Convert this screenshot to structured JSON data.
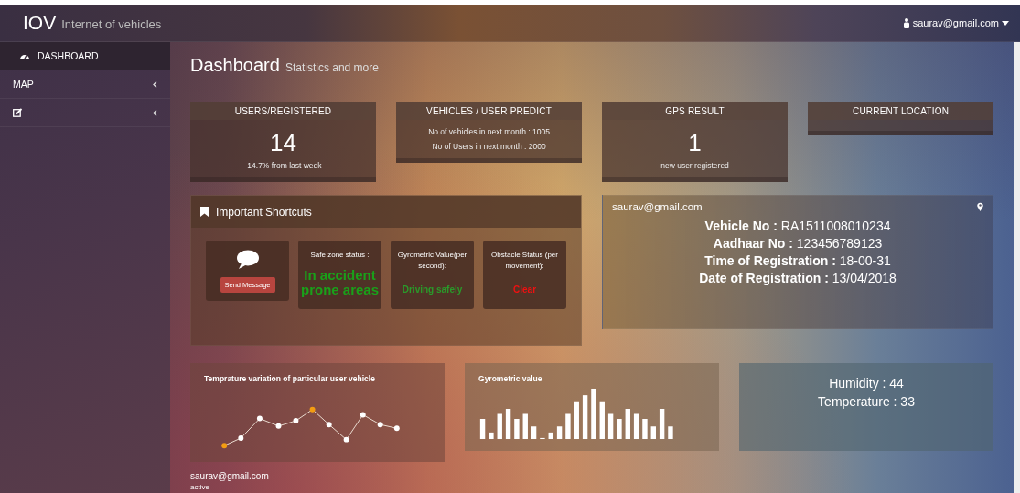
{
  "navbar": {
    "brand": "IOV",
    "tagline": "Internet of vehicles",
    "user": "saurav@gmail.com"
  },
  "sidebar": {
    "items": [
      {
        "kind": "dashboard",
        "label": "DASHBOARD",
        "selected": true
      },
      {
        "kind": "map",
        "label": "MAP",
        "selected": false
      },
      {
        "kind": "edit",
        "selected": false
      }
    ]
  },
  "page": {
    "title": "Dashboard",
    "subtitle": "Statistics and more"
  },
  "stat_cards": [
    {
      "title": "USERS/REGISTERED",
      "big": "14",
      "lines": [
        "-14.7% from last week"
      ]
    },
    {
      "title": "VEHICLES / USER PREDICT",
      "lines": [
        "No of vehicles in next month : 1005",
        "No of Users in next month : 2000"
      ]
    },
    {
      "title": "GPS RESULT",
      "big": "1",
      "lines": [
        "new user registered"
      ]
    },
    {
      "title": "CURRENT LOCATION"
    }
  ],
  "shortcuts": {
    "title": "Important Shortcuts",
    "tiles": [
      {
        "kind": "message",
        "button": "Send Message"
      },
      {
        "kind": "status-large",
        "label": "Safe zone status :",
        "value": "In accident prone areas",
        "color": "#1aa01a"
      },
      {
        "kind": "status",
        "label": "Gyrometric Value(per second):",
        "value": "Driving safely",
        "color": "#2a9a2a"
      },
      {
        "kind": "status",
        "label": "Obstacle Status (per movement):",
        "value": "Clear",
        "color": "#ee1111"
      }
    ]
  },
  "vehicle_info": {
    "email": "saurav@gmail.com",
    "lines": [
      "**Vehicle No :** RA1511008010234",
      "**Aadhaar No :** 123456789123",
      "**Time of Registration :** 18-00-31",
      "**Date of Registration :** 13/04/2018"
    ]
  },
  "temperature_chart": {
    "title": "Temprature variation of particular user vehicle"
  },
  "gyro_chart": {
    "title": "Gyrometric value"
  },
  "environment": {
    "lines": [
      "Humidity : 44",
      "Temperature : 33"
    ]
  },
  "footer": {
    "email": "saurav@gmail.com",
    "status": "active"
  }
}
